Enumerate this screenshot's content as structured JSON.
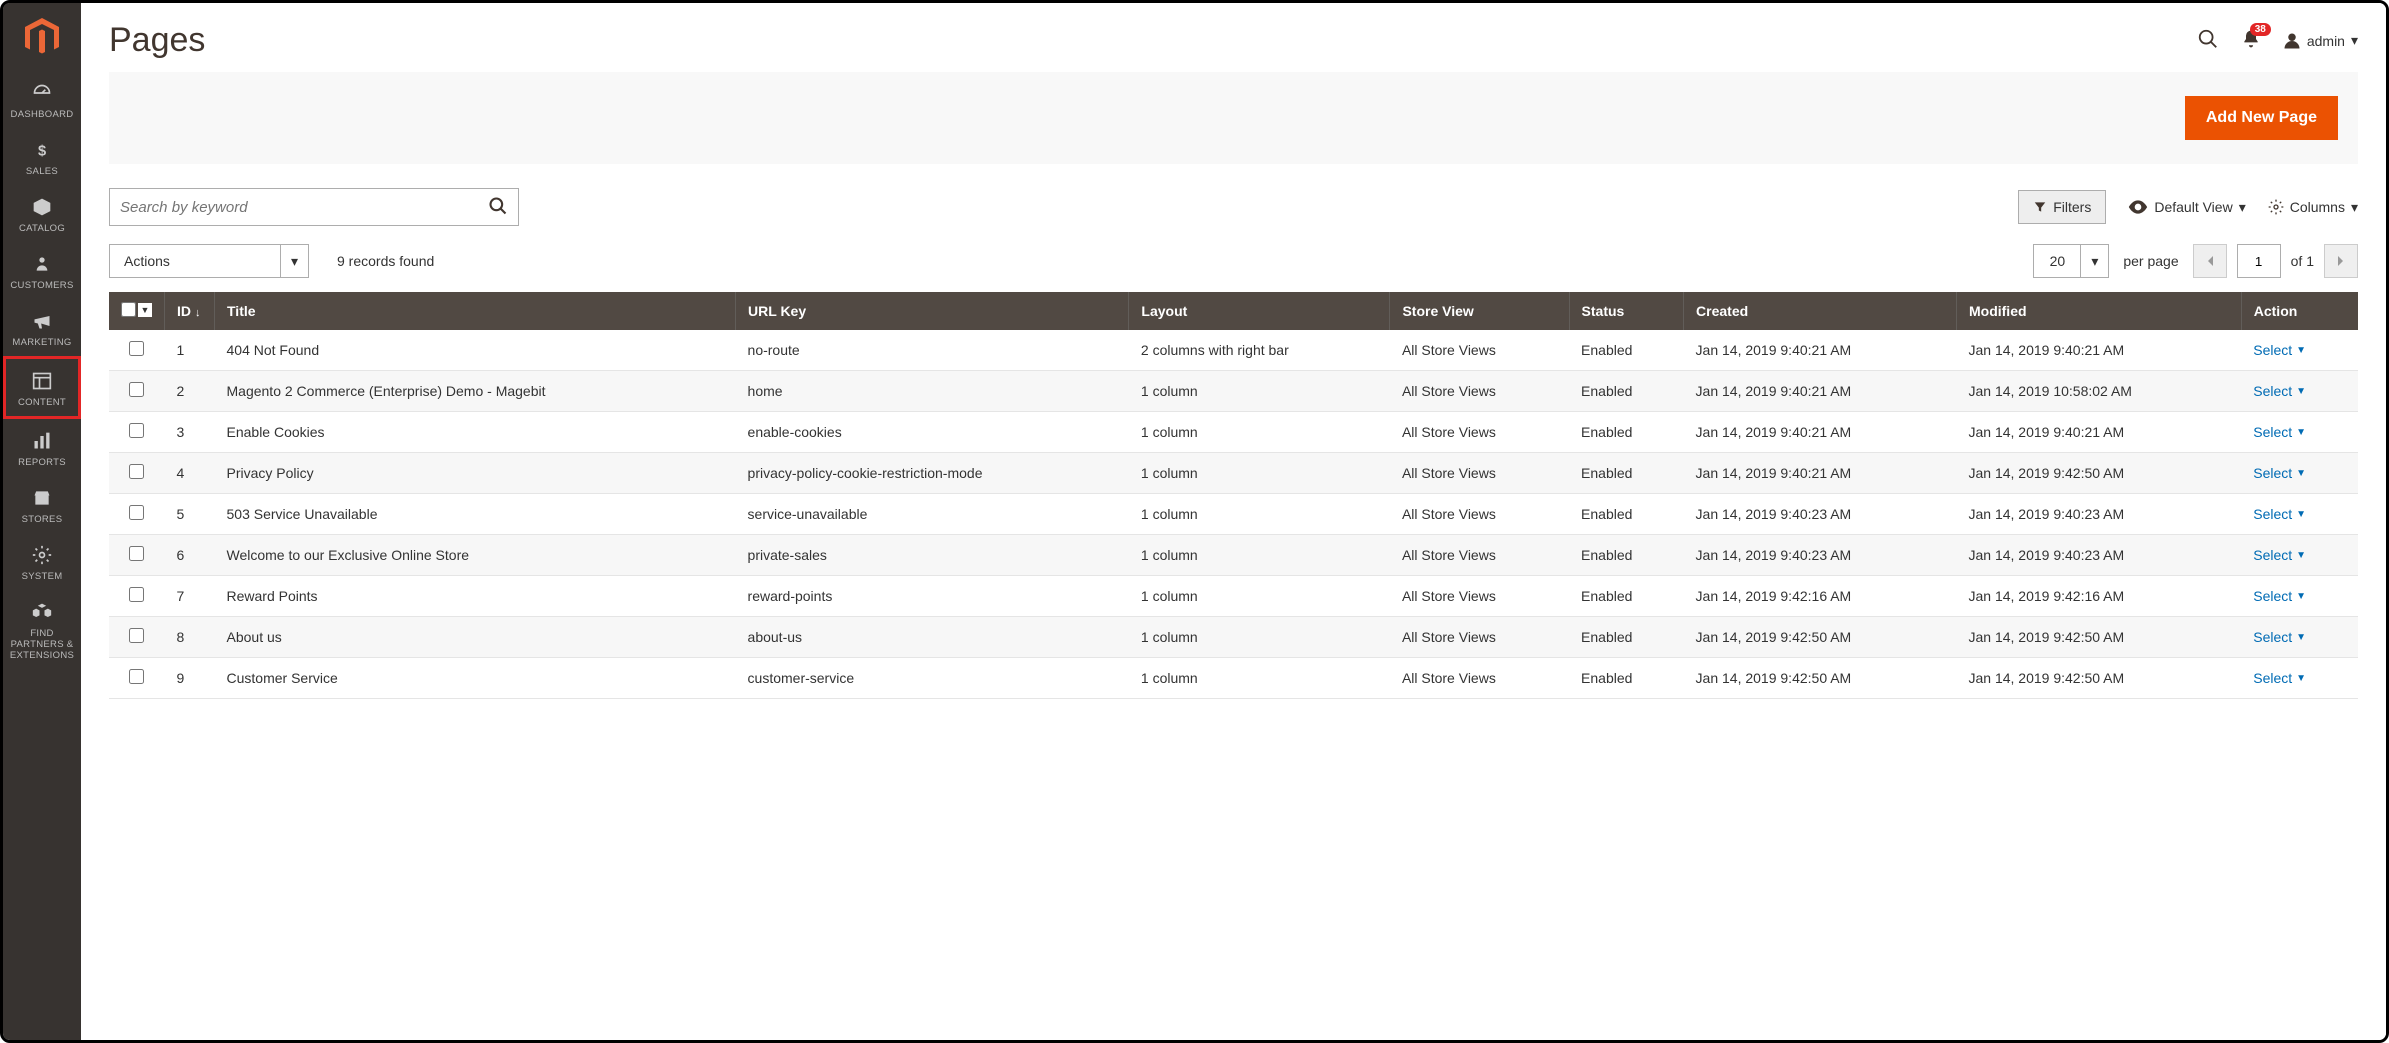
{
  "sidebar": {
    "items": [
      {
        "label": "DASHBOARD",
        "icon": "dashboard-icon"
      },
      {
        "label": "SALES",
        "icon": "dollar-icon"
      },
      {
        "label": "CATALOG",
        "icon": "box-icon"
      },
      {
        "label": "CUSTOMERS",
        "icon": "person-icon"
      },
      {
        "label": "MARKETING",
        "icon": "megaphone-icon"
      },
      {
        "label": "CONTENT",
        "icon": "layout-icon",
        "highlight": true
      },
      {
        "label": "REPORTS",
        "icon": "barchart-icon"
      },
      {
        "label": "STORES",
        "icon": "storefront-icon"
      },
      {
        "label": "SYSTEM",
        "icon": "gear-icon"
      },
      {
        "label": "FIND PARTNERS & EXTENSIONS",
        "icon": "cubes-icon"
      }
    ]
  },
  "header": {
    "title": "Pages",
    "notification_count": "38",
    "username": "admin"
  },
  "actionbar": {
    "primary_button": "Add New Page"
  },
  "toolbar": {
    "search_placeholder": "Search by keyword",
    "filters_label": "Filters",
    "default_view_label": "Default View",
    "columns_label": "Columns",
    "actions_label": "Actions",
    "records_found": "9 records found",
    "per_page_value": "20",
    "per_page_label": "per page",
    "current_page": "1",
    "total_pages_label": "of 1"
  },
  "table": {
    "columns": [
      "ID",
      "Title",
      "URL Key",
      "Layout",
      "Store View",
      "Status",
      "Created",
      "Modified",
      "Action"
    ],
    "select_label": "Select",
    "rows": [
      {
        "id": "1",
        "title": "404 Not Found",
        "url_key": "no-route",
        "layout": "2 columns with right bar",
        "store_view": "All Store Views",
        "status": "Enabled",
        "created": "Jan 14, 2019 9:40:21 AM",
        "modified": "Jan 14, 2019 9:40:21 AM"
      },
      {
        "id": "2",
        "title": "Magento 2 Commerce (Enterprise) Demo - Magebit",
        "url_key": "home",
        "layout": "1 column",
        "store_view": "All Store Views",
        "status": "Enabled",
        "created": "Jan 14, 2019 9:40:21 AM",
        "modified": "Jan 14, 2019 10:58:02 AM"
      },
      {
        "id": "3",
        "title": "Enable Cookies",
        "url_key": "enable-cookies",
        "layout": "1 column",
        "store_view": "All Store Views",
        "status": "Enabled",
        "created": "Jan 14, 2019 9:40:21 AM",
        "modified": "Jan 14, 2019 9:40:21 AM"
      },
      {
        "id": "4",
        "title": "Privacy Policy",
        "url_key": "privacy-policy-cookie-restriction-mode",
        "layout": "1 column",
        "store_view": "All Store Views",
        "status": "Enabled",
        "created": "Jan 14, 2019 9:40:21 AM",
        "modified": "Jan 14, 2019 9:42:50 AM"
      },
      {
        "id": "5",
        "title": "503 Service Unavailable",
        "url_key": "service-unavailable",
        "layout": "1 column",
        "store_view": "All Store Views",
        "status": "Enabled",
        "created": "Jan 14, 2019 9:40:23 AM",
        "modified": "Jan 14, 2019 9:40:23 AM"
      },
      {
        "id": "6",
        "title": "Welcome to our Exclusive Online Store",
        "url_key": "private-sales",
        "layout": "1 column",
        "store_view": "All Store Views",
        "status": "Enabled",
        "created": "Jan 14, 2019 9:40:23 AM",
        "modified": "Jan 14, 2019 9:40:23 AM"
      },
      {
        "id": "7",
        "title": "Reward Points",
        "url_key": "reward-points",
        "layout": "1 column",
        "store_view": "All Store Views",
        "status": "Enabled",
        "created": "Jan 14, 2019 9:42:16 AM",
        "modified": "Jan 14, 2019 9:42:16 AM"
      },
      {
        "id": "8",
        "title": "About us",
        "url_key": "about-us",
        "layout": "1 column",
        "store_view": "All Store Views",
        "status": "Enabled",
        "created": "Jan 14, 2019 9:42:50 AM",
        "modified": "Jan 14, 2019 9:42:50 AM"
      },
      {
        "id": "9",
        "title": "Customer Service",
        "url_key": "customer-service",
        "layout": "1 column",
        "store_view": "All Store Views",
        "status": "Enabled",
        "created": "Jan 14, 2019 9:42:50 AM",
        "modified": "Jan 14, 2019 9:42:50 AM"
      }
    ]
  },
  "colors": {
    "brand_orange": "#eb5202",
    "sidebar_bg": "#373330",
    "table_header_bg": "#514943",
    "link_blue": "#006bb4",
    "badge_red": "#e22626"
  }
}
